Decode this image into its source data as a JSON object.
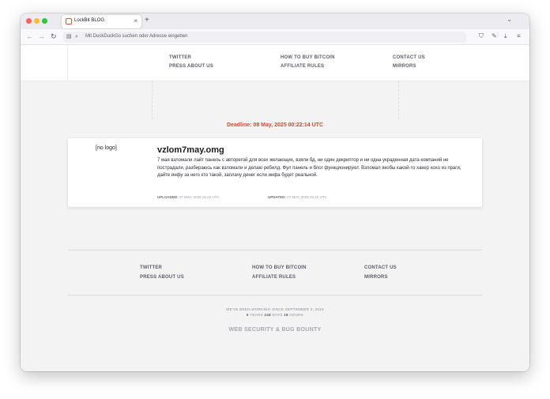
{
  "browser": {
    "tab_title": "LockBit BLOG",
    "tab_close": "×",
    "new_tab": "+",
    "tab_list": "⌄",
    "url_placeholder": "Mit DuckDuckGo suchen oder Adresse eingeben",
    "colors": {
      "close": "#ff5f57",
      "minimize": "#febc2e",
      "maximize": "#28c840",
      "favicon": "#d4562d"
    }
  },
  "nav": {
    "items": [
      {
        "label": "TWITTER"
      },
      {
        "label": "HOW TO BUY BITCOIN"
      },
      {
        "label": "CONTACT US"
      },
      {
        "label": "PRESS ABOUT US"
      },
      {
        "label": "AFFILIATE RULES"
      },
      {
        "label": "MIRRORS"
      }
    ]
  },
  "deadline": "Deadline: 08 May, 2025 00:22:14 UTC",
  "post": {
    "logo": "[no logo]",
    "title": "vzlom7may.omg",
    "body": "7 мая взломали лайт панель с авторегой для всех желающих, взяли бд, ни один декриптор и ни одна украденная дата компаний не пострадали, разбираюсь как взломали и делаю ребилд. Фул панель и блог функционируют. Взломал якобы какой-то хакер хохо из праги, дайте инфу за него кто такой, заплачу денег если инфа будет реальной.",
    "uploaded_label": "UPLOADED:",
    "uploaded_value": "07 MAY, 2025 22:22 UTC",
    "updated_label": "UPDATED:",
    "updated_value": "07 MAY, 2025 22:22 UTC"
  },
  "footer": {
    "working_since": "WE'VE BEEN WORKING SINCE SEPTEMBER 3, 2019",
    "years": "5",
    "years_label": "YEARS",
    "days": "248",
    "days_label": "DAYS",
    "hours": "18",
    "hours_label": "HOURS",
    "brand": "WEB SECURITY & BUG BOUNTY"
  },
  "accent_color": "#e0442b"
}
